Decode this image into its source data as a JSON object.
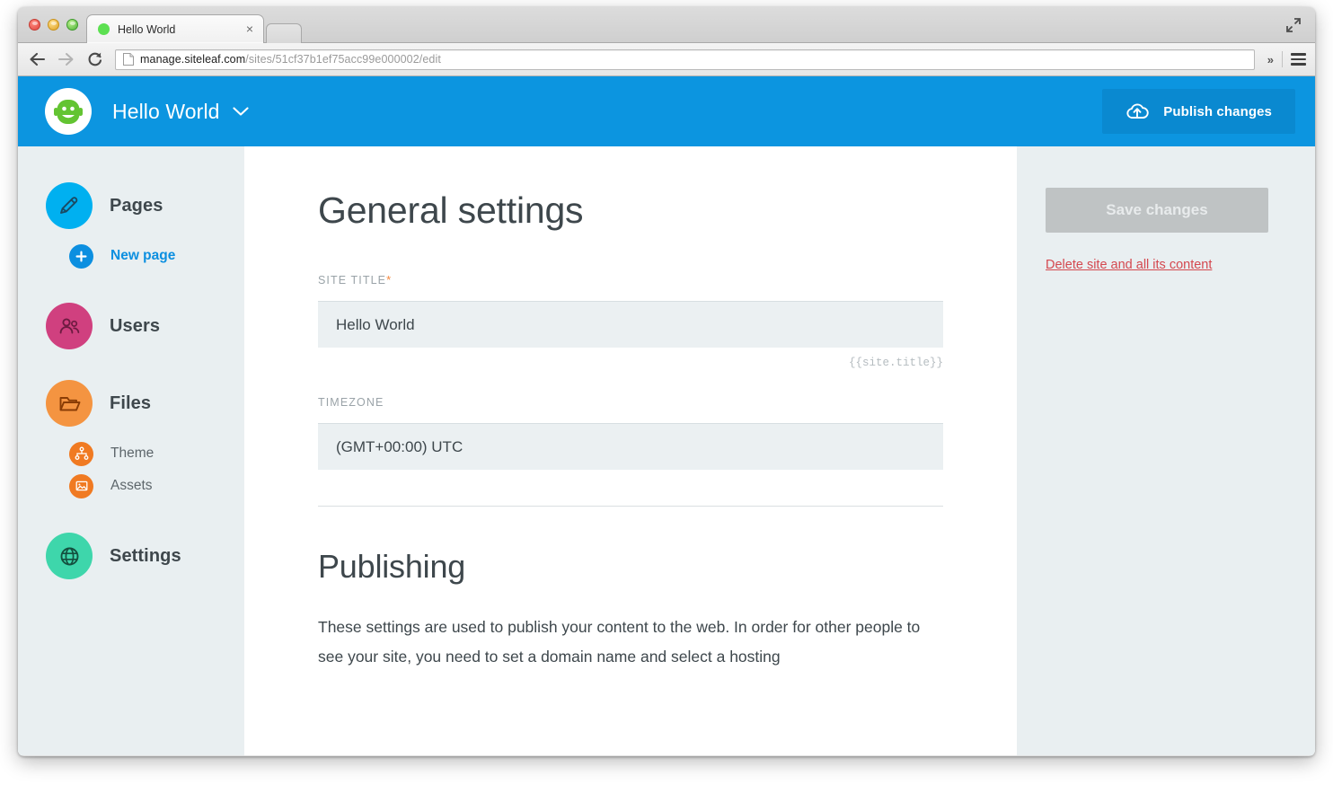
{
  "browser": {
    "tab": {
      "title": "Hello World",
      "close_label": "×",
      "favicon": "green-circle-favicon"
    },
    "toolbar": {
      "back_icon": "back-arrow-icon",
      "forward_icon": "forward-arrow-icon",
      "reload_icon": "reload-icon",
      "url_host": "manage.siteleaf.com",
      "url_path": "/sites/51cf37b1ef75acc99e000002/edit",
      "overflow_label": "»",
      "menu_icon": "hamburger-menu-icon"
    },
    "window_controls": {
      "close": "close-window-button",
      "minimize": "minimize-window-button",
      "zoom": "zoom-window-button",
      "maximize_icon": "fullscreen-icon"
    }
  },
  "appbar": {
    "logo": "siteleaf-robot-logo",
    "site_name": "Hello World",
    "caret_icon": "chevron-down-icon",
    "publish": {
      "label": "Publish changes",
      "icon": "cloud-upload-icon"
    },
    "background_color": "#0c95e0"
  },
  "sidebar": {
    "items": [
      {
        "label": "Pages",
        "icon": "pencil-icon",
        "color": "#00b0f0",
        "level": "primary"
      },
      {
        "label": "New page",
        "icon": "plus-icon",
        "color": "#0c8fe0",
        "level": "sub",
        "is_link": true
      },
      {
        "label": "Users",
        "icon": "users-icon",
        "color": "#d0407f",
        "level": "primary"
      },
      {
        "label": "Files",
        "icon": "folder-icon",
        "color": "#f49441",
        "level": "primary"
      },
      {
        "label": "Theme",
        "icon": "theme-nodes-icon",
        "color": "#f07a22",
        "level": "sub"
      },
      {
        "label": "Assets",
        "icon": "image-icon",
        "color": "#f07a22",
        "level": "sub"
      },
      {
        "label": "Settings",
        "icon": "globe-icon",
        "color": "#3ed6ab",
        "level": "primary"
      }
    ]
  },
  "main": {
    "page_title": "General settings",
    "fields": [
      {
        "label": "SITE TITLE",
        "required_marker": "*",
        "value": "Hello World",
        "hint": "{{site.title}}"
      },
      {
        "label": "TIMEZONE",
        "required_marker": "",
        "value": "(GMT+00:00) UTC",
        "hint": ""
      }
    ],
    "section": {
      "title": "Publishing",
      "paragraph": "These settings are used to publish your content to the web. In order for other people to see your site, you need to set a domain name and select a hosting"
    }
  },
  "rail": {
    "save_label": "Save changes",
    "save_enabled": false,
    "delete_label": "Delete site and all its content",
    "delete_color": "#d4484f"
  }
}
